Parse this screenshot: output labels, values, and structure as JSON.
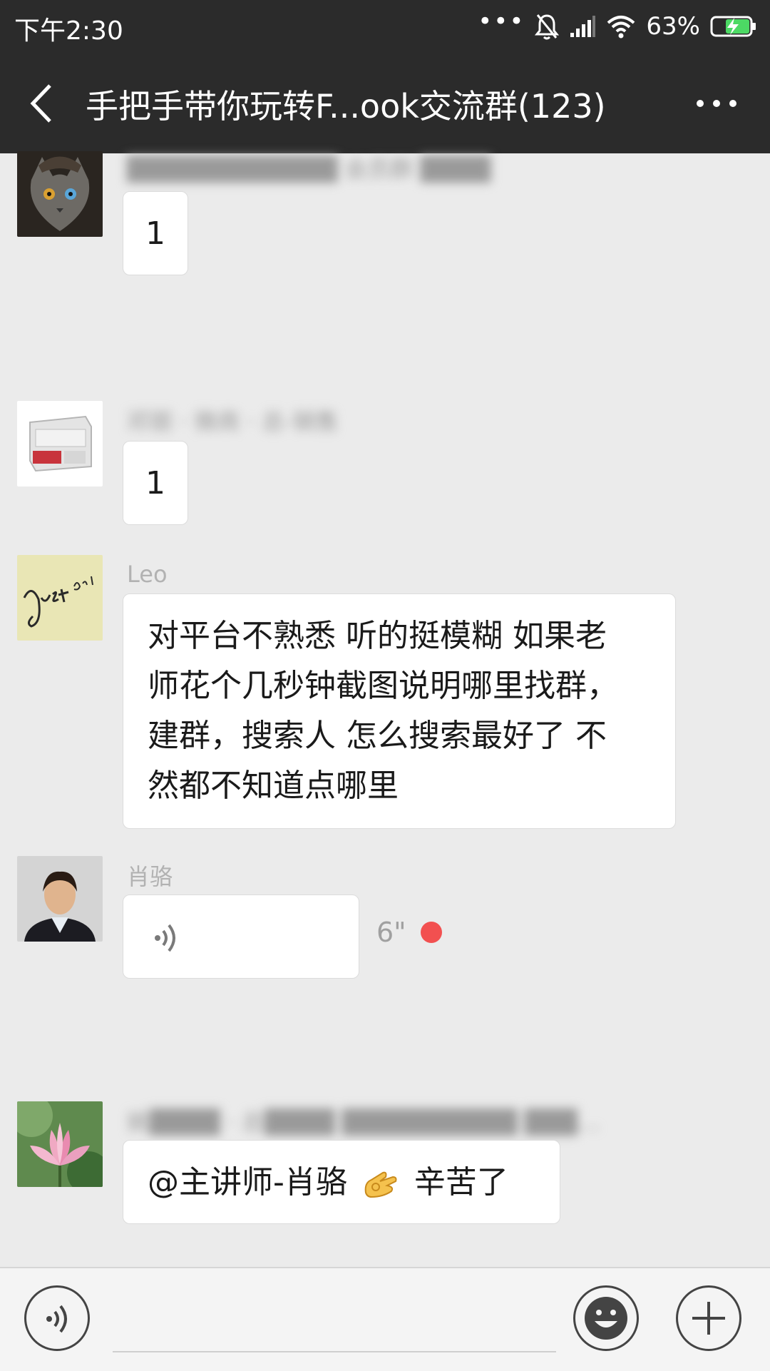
{
  "status": {
    "time": "下午2:30",
    "battery": "63%"
  },
  "header": {
    "title": "手把手带你玩转F...ook交流群(123)"
  },
  "messages": [
    {
      "sender": "████████████ 会员群 ████",
      "text": "1"
    },
    {
      "sender": "邓丽 · 微商 · 总-销售",
      "text": "1"
    },
    {
      "sender": "Leo",
      "lines": [
        "对平台不熟悉 听的挺模糊 如果老",
        "师花个几秒钟截图说明哪里找群，",
        "建群，搜索人 怎么搜索最好了 不",
        "然都不知道点哪里"
      ]
    },
    {
      "sender": "肖骆",
      "voice_duration": "6\""
    },
    {
      "sender": "姚████ · 总████ ██████████ ███…",
      "text": "@主讲师-肖骆 ",
      "text_after": "辛苦了"
    }
  ],
  "colors": {
    "bar": "#2b2b2b",
    "background": "#ebebeb",
    "unread": "#f25050"
  }
}
